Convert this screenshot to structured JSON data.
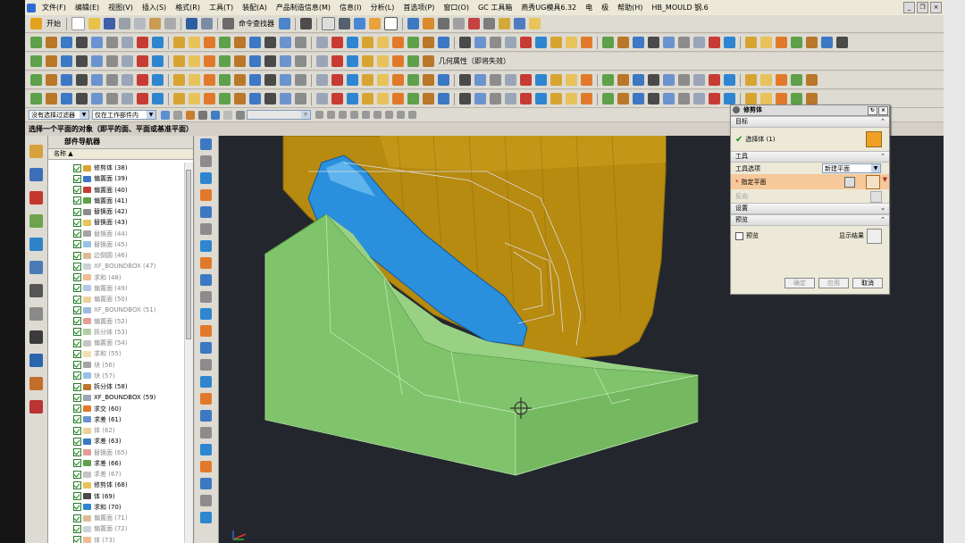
{
  "menu": [
    "文件(F)",
    "编辑(E)",
    "视图(V)",
    "插入(S)",
    "格式(R)",
    "工具(T)",
    "装配(A)",
    "产品制造信息(M)",
    "信息(I)",
    "分析(L)",
    "首选项(P)",
    "窗口(O)",
    "GC 工具箱",
    "燕秀UG模具6.32",
    "电",
    "极",
    "帮助(H)",
    "HB_MOULD 钢.6"
  ],
  "toolbar": {
    "start_label": "开始",
    "command_finder": "命令查找器",
    "assoc_label": "几何属性（即将失效）"
  },
  "selection_bar": {
    "filter": "没有选择过滤器",
    "scope": "仅在工作部件内",
    "disabled_combo": "",
    "cue": "选择一个平面的对象（即平的面、平面或基准平面）"
  },
  "navigator": {
    "title": "部件导航器",
    "column": "名称",
    "items": [
      {
        "label": "修剪体 (38)",
        "active": true
      },
      {
        "label": "偏置面 (39)",
        "active": true
      },
      {
        "label": "偏置面 (40)",
        "active": true
      },
      {
        "label": "偏置面 (41)",
        "active": true
      },
      {
        "label": "替换面 (42)",
        "active": true
      },
      {
        "label": "替换面 (43)",
        "active": true
      },
      {
        "label": "替换面 (44)",
        "active": false
      },
      {
        "label": "替换面 (45)",
        "active": false
      },
      {
        "label": "边倒圆 (46)",
        "active": false
      },
      {
        "label": "XF_BOUNDBOX (47)",
        "active": false
      },
      {
        "label": "求和 (48)",
        "active": false
      },
      {
        "label": "偏置面 (49)",
        "active": false
      },
      {
        "label": "偏置面 (50)",
        "active": false
      },
      {
        "label": "XF_BOUNDBOX (51)",
        "active": false
      },
      {
        "label": "偏置面 (52)",
        "active": false
      },
      {
        "label": "拆分体 (53)",
        "active": false
      },
      {
        "label": "偏置面 (54)",
        "active": false
      },
      {
        "label": "求和 (55)",
        "active": false
      },
      {
        "label": "块 (56)",
        "active": false
      },
      {
        "label": "块 (57)",
        "active": false
      },
      {
        "label": "拆分体 (58)",
        "active": true
      },
      {
        "label": "XF_BOUNDBOX (59)",
        "active": true
      },
      {
        "label": "求交 (60)",
        "active": true
      },
      {
        "label": "求差 (61)",
        "active": true
      },
      {
        "label": "体 (62)",
        "active": false
      },
      {
        "label": "求差 (63)",
        "active": true
      },
      {
        "label": "替换面 (65)",
        "active": false
      },
      {
        "label": "求差 (66)",
        "active": true
      },
      {
        "label": "求差 (67)",
        "active": false
      },
      {
        "label": "修剪体 (68)",
        "active": true
      },
      {
        "label": "体 (69)",
        "active": true
      },
      {
        "label": "求和 (70)",
        "active": true
      },
      {
        "label": "偏置面 (71)",
        "active": false
      },
      {
        "label": "偏置面 (72)",
        "active": false
      },
      {
        "label": "体 (73)",
        "active": false
      },
      {
        "label": "XF_BOUNDBOX (74)",
        "active": false
      }
    ]
  },
  "dialog": {
    "title": "修剪体",
    "target_section": "目标",
    "select_body": "选择体 (1)",
    "tool_section": "工具",
    "tool_option_label": "工具选项",
    "tool_option_value": "新建平面",
    "specify_plane": "指定平面",
    "direction": "反向",
    "settings_section": "设置",
    "preview_section": "预览",
    "preview_label": "预览",
    "show_result": "显示结果",
    "ok": "确定",
    "apply": "应用",
    "cancel": "取消"
  },
  "colors": {
    "green_body": "#7fc46a",
    "blue_part": "#2a8fdc",
    "gold_body": "#b78a10",
    "viewport_bg": "#23272d"
  }
}
